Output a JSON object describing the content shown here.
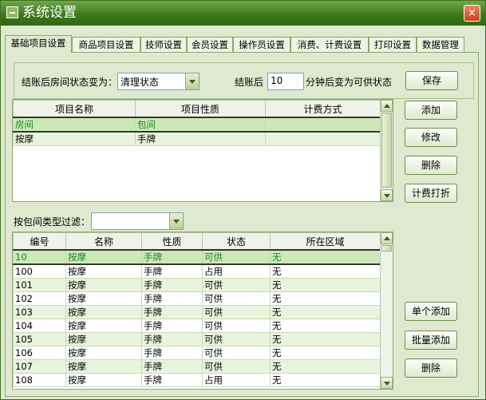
{
  "window": {
    "title": "系统设置",
    "close_glyph": "×"
  },
  "tabs": [
    "基础项目设置",
    "商品项目设置",
    "技师设置",
    "会员设置",
    "操作员设置",
    "消费、计费设置",
    "打印设置",
    "数据管理"
  ],
  "settings": {
    "room_status_label": "结账后房间状态变为：",
    "room_status_value": "清理状态",
    "minutes_label_before": "结账后",
    "minutes_value": "10",
    "minutes_label_after": "分钟后变为可供状态",
    "save_button": "保存"
  },
  "items_table": {
    "headers": [
      "项目名称",
      "项目性质",
      "计费方式"
    ],
    "rows": [
      [
        "房间",
        "包间",
        ""
      ],
      [
        "按摩",
        "手牌",
        ""
      ]
    ]
  },
  "right_buttons": {
    "add": "添加",
    "edit": "修改",
    "delete": "删除",
    "billing_discount": "计费打折"
  },
  "filter": {
    "label": "按包间类型过滤：",
    "value": ""
  },
  "rooms_table": {
    "headers": [
      "编号",
      "名称",
      "性质",
      "状态",
      "所在区域"
    ],
    "rows": [
      [
        "10",
        "按摩",
        "手牌",
        "可供",
        "无"
      ],
      [
        "100",
        "按摩",
        "手牌",
        "占用",
        "无"
      ],
      [
        "101",
        "按摩",
        "手牌",
        "可供",
        "无"
      ],
      [
        "102",
        "按摩",
        "手牌",
        "可供",
        "无"
      ],
      [
        "103",
        "按摩",
        "手牌",
        "可供",
        "无"
      ],
      [
        "104",
        "按摩",
        "手牌",
        "可供",
        "无"
      ],
      [
        "105",
        "按摩",
        "手牌",
        "可供",
        "无"
      ],
      [
        "106",
        "按摩",
        "手牌",
        "可供",
        "无"
      ],
      [
        "107",
        "按摩",
        "手牌",
        "可供",
        "无"
      ],
      [
        "108",
        "按摩",
        "手牌",
        "占用",
        "无"
      ]
    ]
  },
  "bottom_buttons": {
    "single_add": "单个添加",
    "batch_add": "批量添加",
    "delete": "删除"
  },
  "colors": {
    "titlebar": "#3e7a1e",
    "selected_text": "#1a8a22",
    "alt_row": "#e9f4dc"
  }
}
